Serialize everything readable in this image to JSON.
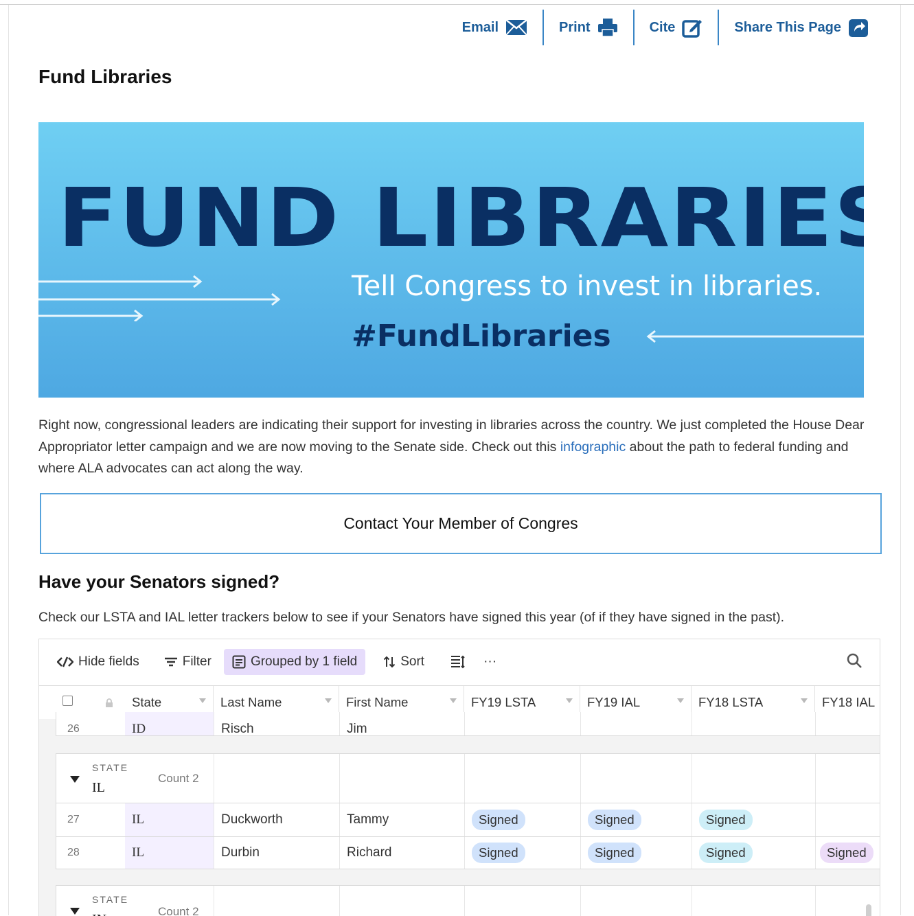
{
  "toolbar": {
    "email": "Email",
    "print": "Print",
    "cite": "Cite",
    "share": "Share This Page"
  },
  "page_title": "Fund Libraries",
  "banner": {
    "headline": "FUND LIBRARIES",
    "tagline": "Tell Congress to invest in libraries.",
    "hashtag": "#FundLibraries"
  },
  "intro": {
    "text_before": "Right now, congressional leaders are indicating their support for investing in libraries across the country. We just completed the House Dear Appropriator letter campaign and we are now moving to the Senate side. Check out this ",
    "link": "infographic",
    "text_after": " about the path to federal funding and where ALA advocates can act along the way."
  },
  "contact_button": "Contact Your Member of Congres",
  "senators_heading": "Have your Senators signed?",
  "senators_desc": "Check our LSTA and IAL letter trackers below to see if your Senators have signed this year (of if they have signed in the past).",
  "grid_toolbar": {
    "hide_fields": "Hide fields",
    "filter": "Filter",
    "grouped": "Grouped by 1 field",
    "sort": "Sort",
    "more": "···"
  },
  "columns": [
    "State",
    "Last Name",
    "First Name",
    "FY19 LSTA",
    "FY19 IAL",
    "FY18 LSTA",
    "FY18 IAL"
  ],
  "partial_row": {
    "num": "26",
    "state": "ID",
    "last": "Risch",
    "first": "Jim"
  },
  "groups": [
    {
      "label": "STATE",
      "value": "IL",
      "count": "Count 2",
      "rows": [
        {
          "num": "27",
          "state": "IL",
          "last": "Duckworth",
          "first": "Tammy",
          "fy19_lsta": "Signed",
          "fy19_ial": "Signed",
          "fy18_lsta": "Signed",
          "fy18_ial": ""
        },
        {
          "num": "28",
          "state": "IL",
          "last": "Durbin",
          "first": "Richard",
          "fy19_lsta": "Signed",
          "fy19_ial": "Signed",
          "fy18_lsta": "Signed",
          "fy18_ial": "Signed"
        }
      ]
    },
    {
      "label": "STATE",
      "value": "IN",
      "count": "Count 2"
    }
  ],
  "colors": {
    "link": "#1c5d99",
    "banner_dark": "#0a2f63",
    "group_highlight": "#e6dcfb"
  }
}
